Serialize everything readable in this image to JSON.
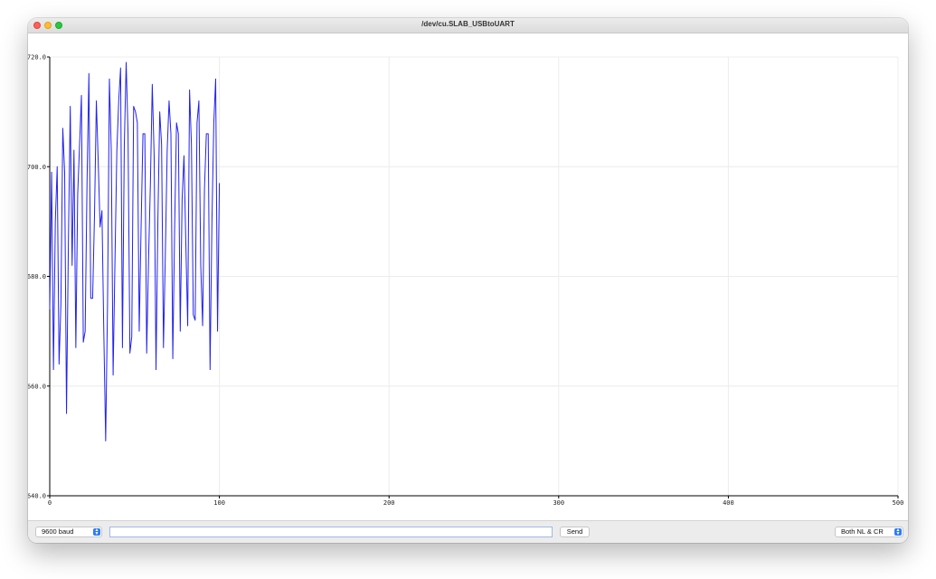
{
  "window": {
    "title": "/dev/cu.SLAB_USBtoUART"
  },
  "chart_data": {
    "type": "line",
    "title": "",
    "xlabel": "",
    "ylabel": "",
    "xlim": [
      0,
      500
    ],
    "ylim": [
      640,
      720
    ],
    "x_ticks": [
      "0",
      "100",
      "200",
      "300",
      "400",
      "500"
    ],
    "y_ticks": [
      "640.0",
      "660.0",
      "680.0",
      "700.0",
      "720.0"
    ],
    "grid": true,
    "series": [
      {
        "color": "#2222ee",
        "values": [
          674,
          699,
          663,
          690,
          700,
          664,
          675,
          707,
          699,
          655,
          686,
          711,
          682,
          703,
          667,
          695,
          704,
          713,
          668,
          670,
          697,
          717,
          676,
          676,
          691,
          712,
          701,
          689,
          692,
          670,
          650,
          675,
          716,
          703,
          662,
          683,
          703,
          712,
          718,
          667,
          704,
          719,
          706,
          666,
          669,
          711,
          710,
          708,
          670,
          689,
          706,
          706,
          666,
          683,
          697,
          715,
          702,
          663,
          690,
          710,
          704,
          667,
          684,
          703,
          712,
          706,
          665,
          689,
          708,
          706,
          670,
          694,
          702,
          686,
          671,
          714,
          704,
          673,
          672,
          708,
          712,
          682,
          671,
          696,
          706,
          706,
          663,
          690,
          708,
          716,
          670,
          697
        ]
      }
    ]
  },
  "controls": {
    "baud": "9600 baud",
    "send_value": "",
    "send_label": "Send",
    "line_ending": "Both NL & CR"
  }
}
